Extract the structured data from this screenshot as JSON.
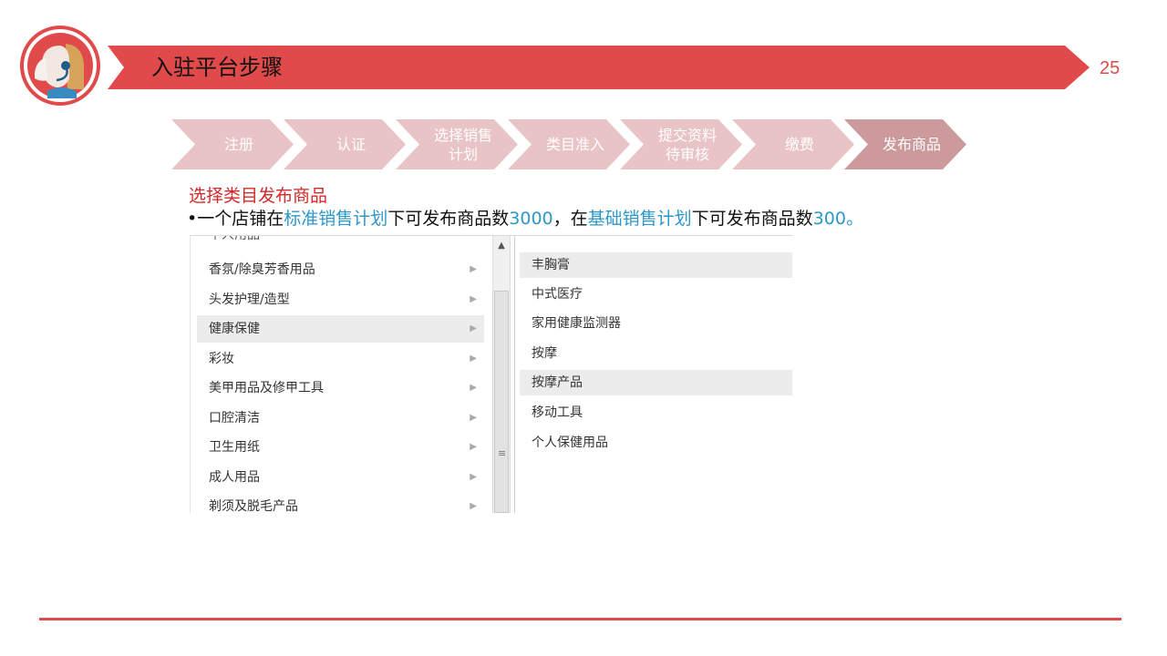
{
  "header": {
    "title": "入驻平台步骤",
    "page_number": "25"
  },
  "steps": [
    {
      "label": "注册",
      "active": false
    },
    {
      "label": "认证",
      "active": false
    },
    {
      "label": "选择销售\n计划",
      "active": false
    },
    {
      "label": "类目准入",
      "active": false
    },
    {
      "label": "提交资料\n待审核",
      "active": false
    },
    {
      "label": "缴费",
      "active": false
    },
    {
      "label": "发布商品",
      "active": true
    }
  ],
  "content": {
    "subtitle": "选择类目发布商品",
    "desc": {
      "bullet": "•",
      "p1": "一个店铺在",
      "link1": "标准销售计划",
      "p2": "下可发布商品数",
      "num1": "3000",
      "p3": "，在",
      "link2": "基础销售计划",
      "p4": "下可发布商品数",
      "num2": "300",
      "p5": "。"
    }
  },
  "category_picker": {
    "cut_item": "个人用品",
    "left_items": [
      {
        "label": "香氛/除臭芳香用品",
        "selected": false
      },
      {
        "label": "头发护理/造型",
        "selected": false
      },
      {
        "label": "健康保健",
        "selected": true
      },
      {
        "label": "彩妆",
        "selected": false
      },
      {
        "label": "美甲用品及修甲工具",
        "selected": false
      },
      {
        "label": "口腔清洁",
        "selected": false
      },
      {
        "label": "卫生用纸",
        "selected": false
      },
      {
        "label": "成人用品",
        "selected": false
      },
      {
        "label": "剃须及脱毛产品",
        "selected": false
      }
    ],
    "right_items": [
      {
        "label": "丰胸膏",
        "highlight": true
      },
      {
        "label": "中式医疗",
        "highlight": false
      },
      {
        "label": "家用健康监测器",
        "highlight": false
      },
      {
        "label": "按摩",
        "highlight": false
      },
      {
        "label": "按摩产品",
        "highlight": true
      },
      {
        "label": "移动工具",
        "highlight": false
      },
      {
        "label": "个人保健用品",
        "highlight": false
      }
    ]
  },
  "colors": {
    "brand_red": "#e04a4a",
    "step_pink": "#e9c4c6",
    "step_active": "#cd9a9c",
    "link_blue": "#2d97c8"
  }
}
